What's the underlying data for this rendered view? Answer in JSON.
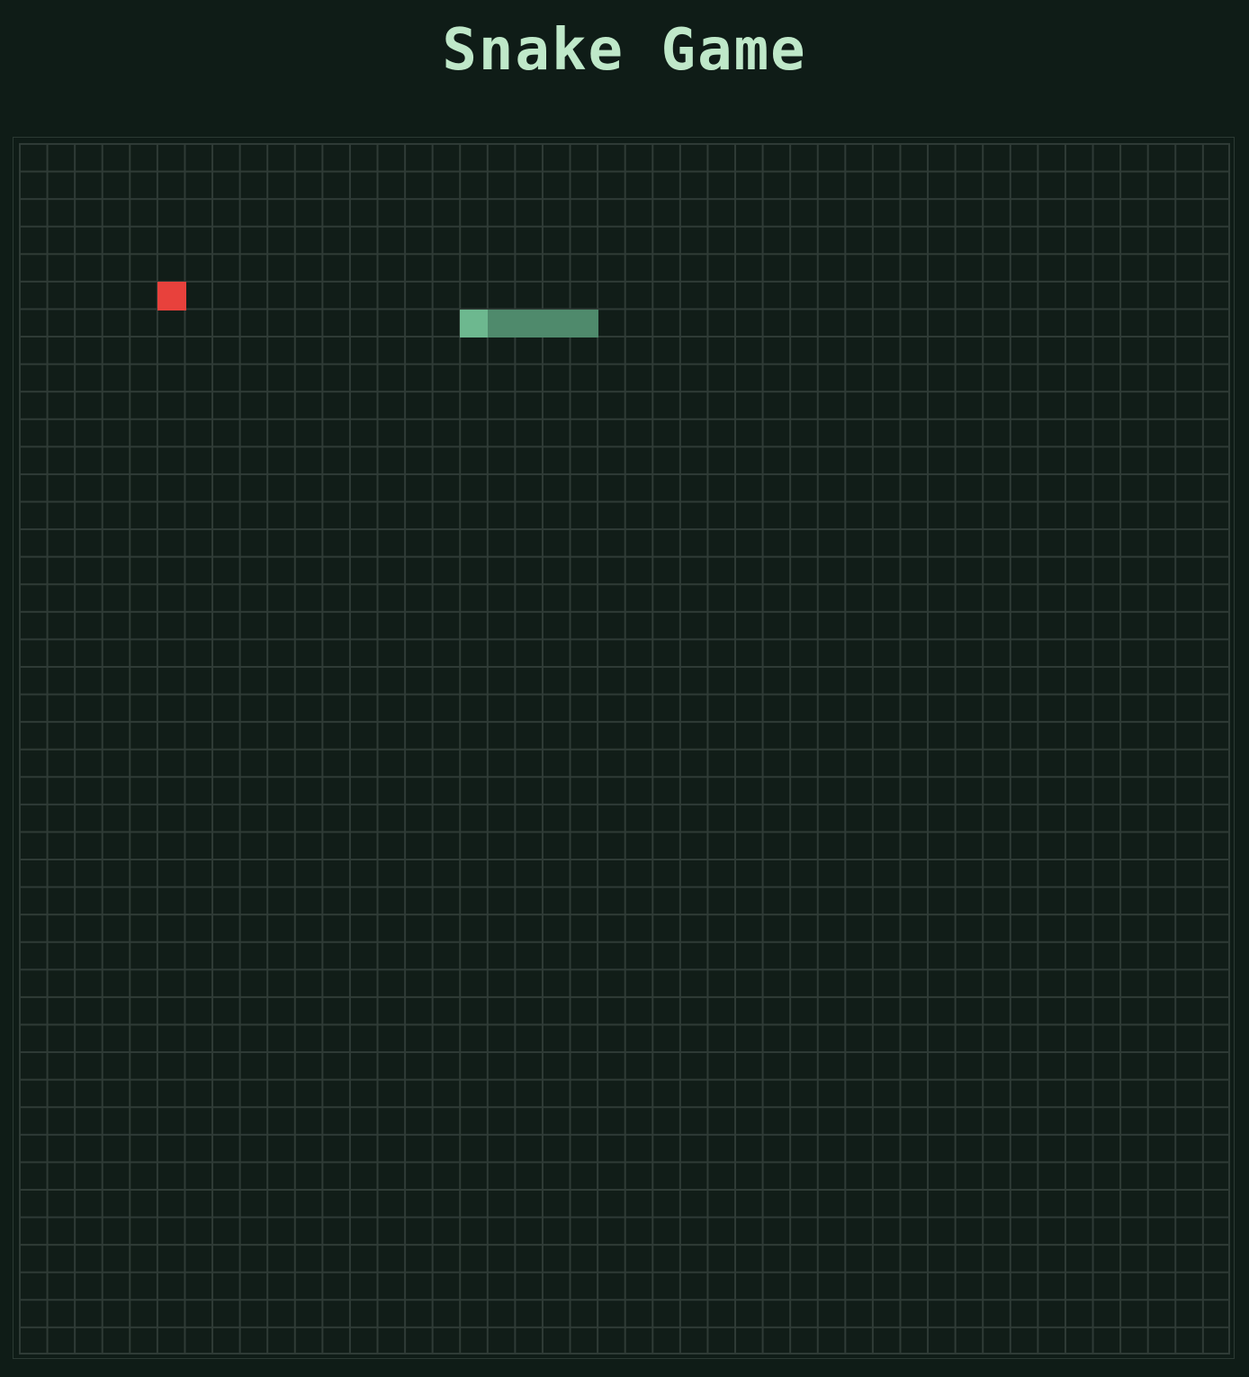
{
  "header": {
    "title": "Snake Game"
  },
  "game": {
    "grid_columns": 44,
    "grid_rows": 44,
    "food": {
      "col": 5,
      "row": 5
    },
    "snake": [
      {
        "col": 16,
        "row": 6
      },
      {
        "col": 17,
        "row": 6
      },
      {
        "col": 18,
        "row": 6
      },
      {
        "col": 19,
        "row": 6
      },
      {
        "col": 20,
        "row": 6
      }
    ],
    "colors": {
      "background": "#0f1c17",
      "grid_line": "#2f3b36",
      "food": "#e8413c",
      "snake_head": "#6db88f",
      "snake_body": "#4f8a6c",
      "title": "#bfe8c9"
    }
  }
}
